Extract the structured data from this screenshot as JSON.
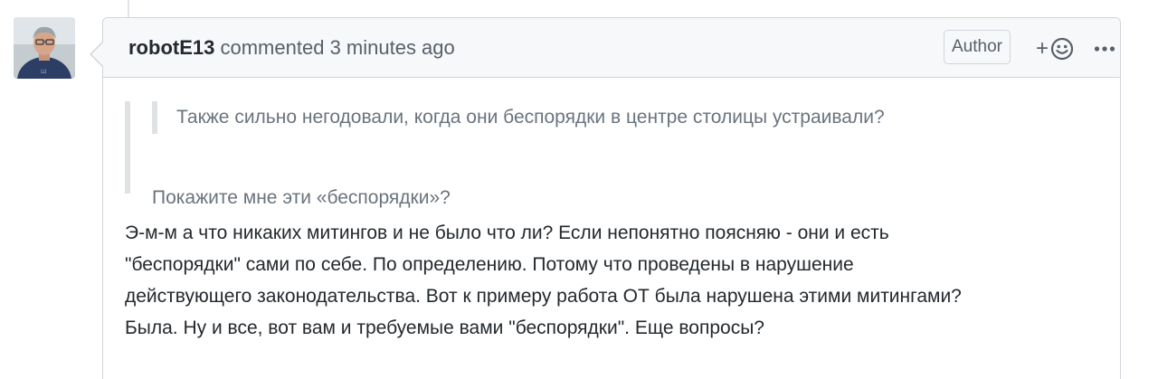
{
  "comment": {
    "author": "robotE13",
    "action": "commented",
    "timestamp": "3 minutes ago",
    "badge": "Author",
    "reaction_plus": "+",
    "nested_quote": "Также сильно негодовали, когда они беспорядки в центре столицы устраивали?",
    "quote": "Покажите мне эти «беспорядки»?",
    "body_lines": [
      "Э-м-м а что никаких митингов и не было что ли? Если непонятно поясняю - они и есть",
      "\"беспорядки\" сами по себе. По определению. Потому что проведены в нарушение",
      "действующего законодательства. Вот к примеру работа ОТ была нарушена этими митингами?",
      "Была. Ну и все, вот вам и требуемые вами \"беспорядки\". Еще вопросы?"
    ]
  },
  "icons": {
    "reaction": "smiley-icon",
    "more": "kebab-horizontal-icon"
  },
  "colors": {
    "header_bg": "#f6f8fa",
    "border": "#d1d5da",
    "quote_text": "#6a737d",
    "quote_bar": "#dfe2e5"
  }
}
